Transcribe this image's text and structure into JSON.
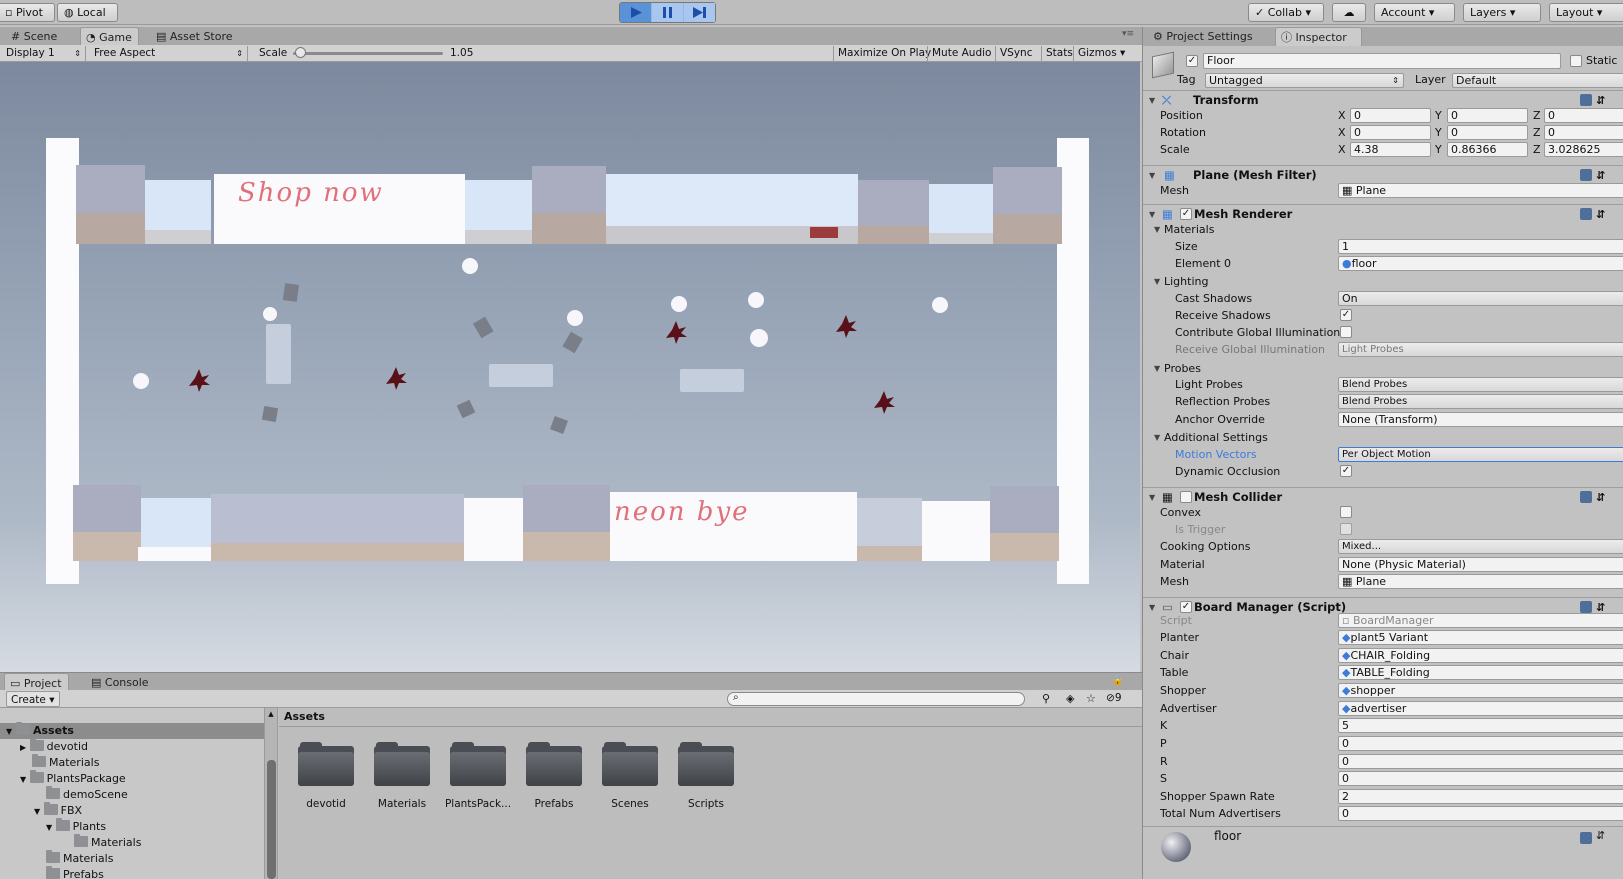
{
  "toolbar": {
    "pivot": "Pivot",
    "local": "Local",
    "collab": "Collab",
    "account": "Account",
    "layers": "Layers",
    "layout": "Layout"
  },
  "game_view": {
    "tabs": [
      "Scene",
      "Game",
      "Asset Store"
    ],
    "display": "Display 1",
    "aspect": "Free Aspect",
    "scale_label": "Scale",
    "scale_value": "1.05",
    "maximize": "Maximize On Play",
    "mute": "Mute Audio",
    "vsync": "VSync",
    "stats": "Stats",
    "gizmos": "Gizmos"
  },
  "inspector": {
    "tabs": [
      "Project Settings",
      "Inspector"
    ],
    "object_name": "Floor",
    "static_label": "Static",
    "tag_label": "Tag",
    "tag_value": "Untagged",
    "layer_label": "Layer",
    "layer_value": "Default",
    "transform": {
      "title": "Transform",
      "position": {
        "label": "Position",
        "x": "0",
        "y": "0",
        "z": "0"
      },
      "rotation": {
        "label": "Rotation",
        "x": "0",
        "y": "0",
        "z": "0"
      },
      "scale": {
        "label": "Scale",
        "x": "4.38",
        "y": "0.86366",
        "z": "3.028625"
      }
    },
    "mesh_filter": {
      "title": "Plane (Mesh Filter)",
      "mesh_label": "Mesh",
      "mesh_value": "Plane"
    },
    "mesh_renderer": {
      "title": "Mesh Renderer",
      "materials": "Materials",
      "size_label": "Size",
      "size_value": "1",
      "element0_label": "Element 0",
      "element0_value": "floor",
      "lighting": "Lighting",
      "cast_shadows_label": "Cast Shadows",
      "cast_shadows_value": "On",
      "receive_shadows_label": "Receive Shadows",
      "contribute_gi_label": "Contribute Global Illumination",
      "receive_gi_label": "Receive Global Illumination",
      "receive_gi_value": "Light Probes",
      "probes": "Probes",
      "light_probes_label": "Light Probes",
      "light_probes_value": "Blend Probes",
      "reflection_probes_label": "Reflection Probes",
      "reflection_probes_value": "Blend Probes",
      "anchor_label": "Anchor Override",
      "anchor_value": "None (Transform)",
      "additional": "Additional Settings",
      "motion_label": "Motion Vectors",
      "motion_value": "Per Object Motion",
      "dynamic_occ_label": "Dynamic Occlusion"
    },
    "mesh_collider": {
      "title": "Mesh Collider",
      "convex_label": "Convex",
      "trigger_label": "Is Trigger",
      "cooking_label": "Cooking Options",
      "cooking_value": "Mixed...",
      "material_label": "Material",
      "material_value": "None (Physic Material)",
      "mesh_label": "Mesh",
      "mesh_value": "Plane"
    },
    "board_manager": {
      "title": "Board Manager (Script)",
      "script_label": "Script",
      "script_value": "BoardManager",
      "planter_label": "Planter",
      "planter_value": "plant5 Variant",
      "chair_label": "Chair",
      "chair_value": "CHAIR_Folding",
      "table_label": "Table",
      "table_value": "TABLE_Folding",
      "shopper_label": "Shopper",
      "shopper_value": "shopper",
      "advertiser_label": "Advertiser",
      "advertiser_value": "advertiser",
      "k_label": "K",
      "k_value": "5",
      "p_label": "P",
      "p_value": "0",
      "r_label": "R",
      "r_value": "0",
      "s_label": "S",
      "s_value": "0",
      "spawn_label": "Shopper Spawn Rate",
      "spawn_value": "2",
      "total_label": "Total Num Advertisers",
      "total_value": "0"
    },
    "material_preview": "floor"
  },
  "project": {
    "tabs": [
      "Project",
      "Console"
    ],
    "create": "Create",
    "hidden_count": "9",
    "assets_header": "Assets",
    "tree": [
      "Assets",
      "devotid",
      "Materials",
      "PlantsPackage",
      "demoScene",
      "FBX",
      "Plants",
      "Materials",
      "Materials",
      "Prefabs"
    ],
    "folders": [
      "devotid",
      "Materials",
      "PlantsPack...",
      "Prefabs",
      "Scenes",
      "Scripts"
    ]
  },
  "scene": {
    "sign_top": "Shop now",
    "sign_bottom": "neon bye"
  },
  "colors": {
    "accent_blue": "#3d7bd8",
    "sign_text": "#e0707a",
    "editor_bg": "#c2c2c2"
  }
}
